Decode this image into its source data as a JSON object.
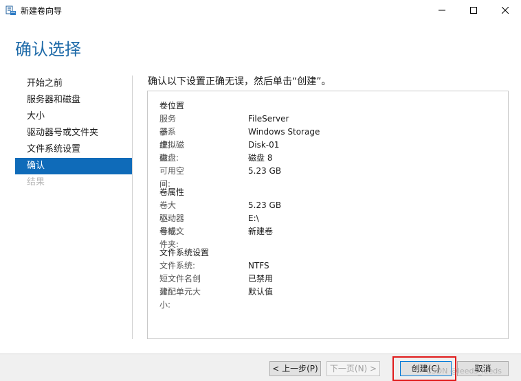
{
  "window": {
    "title": "新建卷向导",
    "icon": "wizard-app-icon"
  },
  "page": {
    "heading": "确认选择",
    "instruction": "确认以下设置正确无误，然后单击“创建”。"
  },
  "nav": {
    "items": [
      {
        "label": "开始之前",
        "state": "normal"
      },
      {
        "label": "服务器和磁盘",
        "state": "normal"
      },
      {
        "label": "大小",
        "state": "normal"
      },
      {
        "label": "驱动器号或文件夹",
        "state": "normal"
      },
      {
        "label": "文件系统设置",
        "state": "normal"
      },
      {
        "label": "确认",
        "state": "active"
      },
      {
        "label": "结果",
        "state": "disabled"
      }
    ]
  },
  "summary": {
    "volume_location": {
      "title": "卷位置",
      "rows": [
        {
          "label": "服务器:",
          "value": "FileServer"
        },
        {
          "label": "子系统:",
          "value": "Windows Storage"
        },
        {
          "label": "虚拟磁盘:",
          "value": "Disk-01"
        },
        {
          "label": "磁盘:",
          "value": "磁盘 8"
        },
        {
          "label": "可用空间:",
          "value": "5.23 GB"
        }
      ]
    },
    "volume_properties": {
      "title": "卷属性",
      "rows": [
        {
          "label": "卷大小:",
          "value": "5.23 GB"
        },
        {
          "label": "驱动器号或文件夹:",
          "value": "E:\\"
        },
        {
          "label": "卷标:",
          "value": "新建卷"
        }
      ]
    },
    "filesystem_settings": {
      "title": "文件系统设置",
      "rows": [
        {
          "label": "文件系统:",
          "value": "NTFS"
        },
        {
          "label": "短文件名创建:",
          "value": "已禁用"
        },
        {
          "label": "分配单元大小:",
          "value": "默认值"
        }
      ]
    }
  },
  "buttons": {
    "previous": "< 上一步(P)",
    "next": "下一页(N) >",
    "create": "创建(C)",
    "cancel": "取消"
  },
  "watermark": "CSDN @leeds_leeds",
  "colors": {
    "accent": "#0f6bb9",
    "heading": "#1e6aa8",
    "highlight": "#e01a1a"
  }
}
